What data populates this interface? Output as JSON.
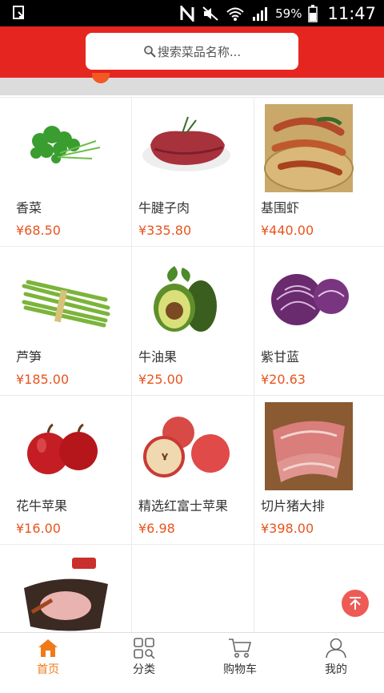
{
  "status_bar": {
    "battery_pct": "59%",
    "time": "11:47"
  },
  "search": {
    "placeholder": "搜索菜品名称..."
  },
  "products": [
    {
      "name": "香菜",
      "price": "¥68.50"
    },
    {
      "name": "牛腱子肉",
      "price": "¥335.80"
    },
    {
      "name": "基围虾",
      "price": "¥440.00"
    },
    {
      "name": "芦笋",
      "price": "¥185.00"
    },
    {
      "name": "牛油果",
      "price": "¥25.00"
    },
    {
      "name": "紫甘蓝",
      "price": "¥20.63"
    },
    {
      "name": "花牛苹果",
      "price": "¥16.00"
    },
    {
      "name": "精选红富士苹果",
      "price": "¥6.98"
    },
    {
      "name": "切片猪大排",
      "price": "¥398.00"
    }
  ],
  "tabs": [
    {
      "label": "首页",
      "icon": "home-icon",
      "active": true
    },
    {
      "label": "分类",
      "icon": "category-icon",
      "active": false
    },
    {
      "label": "购物车",
      "icon": "cart-icon",
      "active": false
    },
    {
      "label": "我的",
      "icon": "user-icon",
      "active": false
    }
  ],
  "colors": {
    "brand_red": "#e5251f",
    "price_orange": "#e8541e",
    "active_tab": "#f07a1a"
  }
}
